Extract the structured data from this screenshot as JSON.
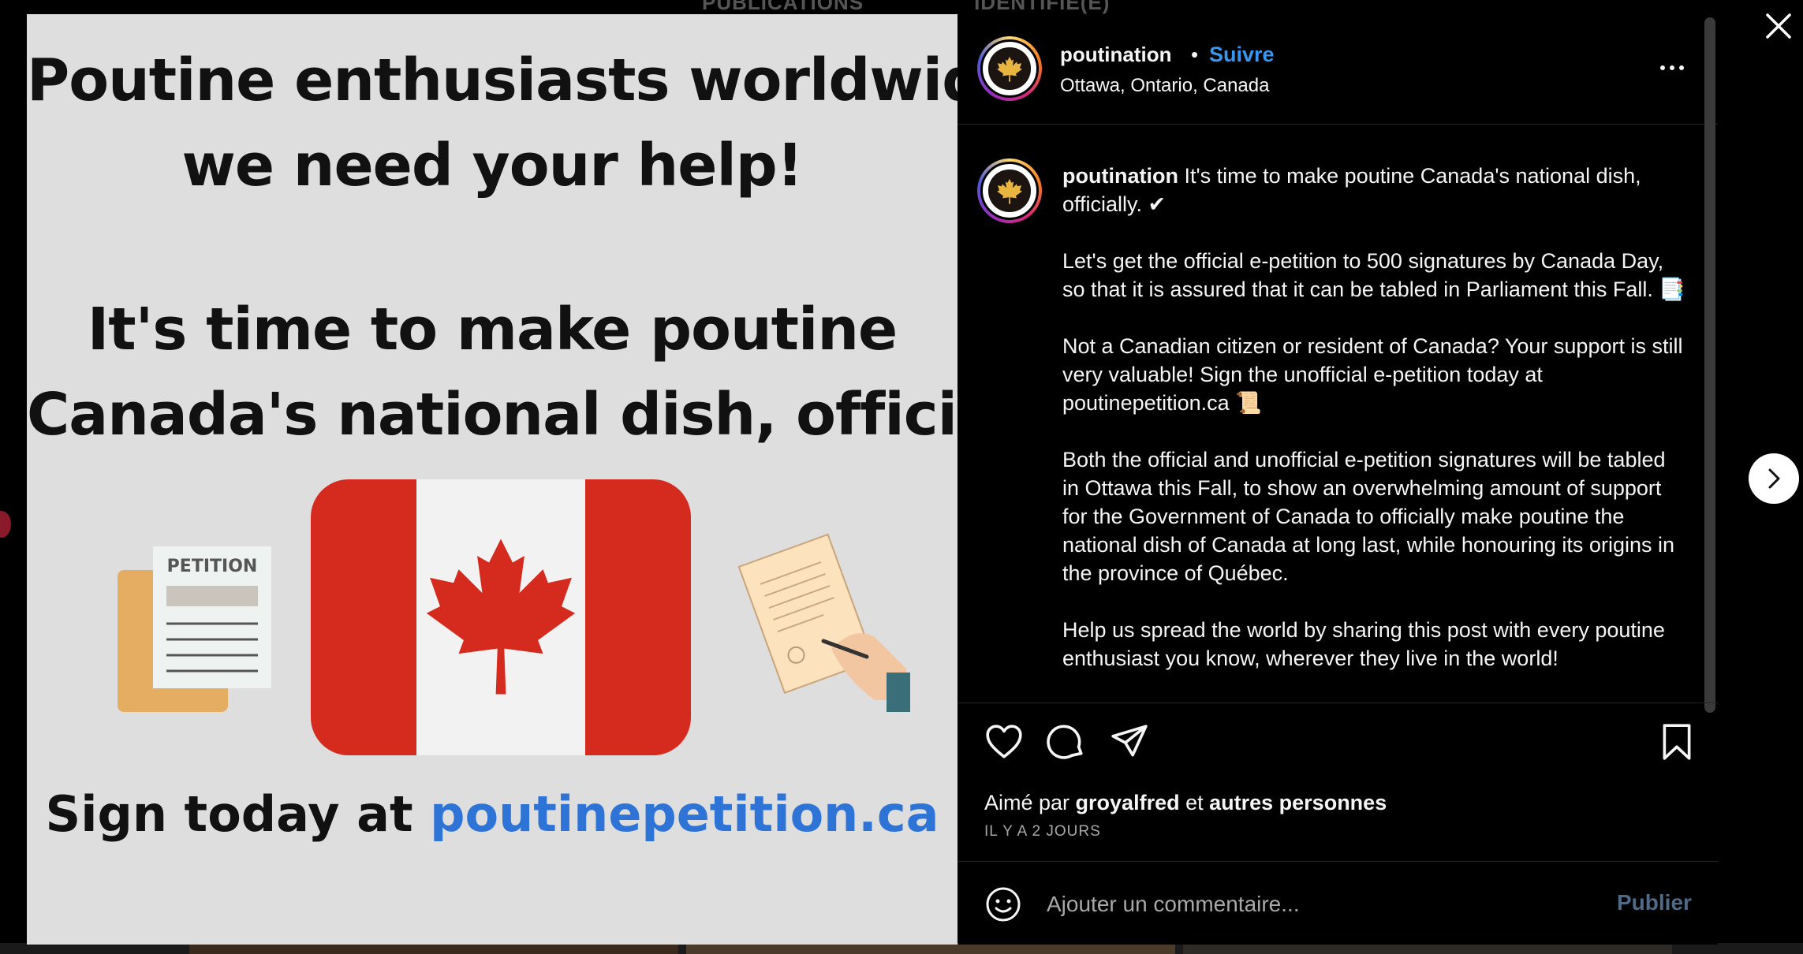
{
  "background": {
    "tabs": [
      "PUBLICATIONS",
      "IDENTIFIÉ(E)"
    ]
  },
  "image": {
    "heading_lines": [
      "Poutine enthusiasts worldwide,",
      "we need your help!"
    ],
    "subheading_lines": [
      "It's time to make poutine",
      "Canada's national dish, officially."
    ],
    "petition_label": "PETITION",
    "cta_prefix": "Sign today at ",
    "cta_url": "poutinepetition.ca",
    "colors": {
      "background": "#dedede",
      "flag_red": "#d52b1e",
      "url_blue": "#2e73d6"
    }
  },
  "header": {
    "username": "poutination",
    "separator": "•",
    "follow_label": "Suivre",
    "location": "Ottawa, Ontario, Canada",
    "more_icon": "more-horizontal-icon"
  },
  "caption": {
    "username": "poutination",
    "first_line": " It's time to make poutine Canada's national dish, officially. ✔",
    "paragraphs": [
      "Let's get the official e-petition to 500 signatures by Canada Day, so that it is assured that it can be tabled in Parliament this Fall. 📑",
      "Not a Canadian citizen or resident of Canada? Your support is still very valuable! Sign the unofficial e-petition today at poutinepetition.ca 📜",
      "Both the official and unofficial e-petition signatures will be tabled in Ottawa this Fall, to show an overwhelming amount of support for the Government of Canada to officially make poutine the national dish of Canada at long last, while honouring its origins in the province of Québec.",
      "Help us spread the world by sharing this post with every poutine enthusiast you know, wherever they live in the world!"
    ]
  },
  "engagement": {
    "liked_prefix": "Aimé par ",
    "liked_user": "groyalfred",
    "liked_and": " et ",
    "liked_others": "autres personnes",
    "timestamp": "IL Y A 2 JOURS"
  },
  "comment": {
    "placeholder": "Ajouter un commentaire...",
    "publish_label": "Publier"
  },
  "colors": {
    "accent": "#3897f0",
    "panel": "#000000",
    "text": "#f5f5f5",
    "muted": "#a8a8a8"
  }
}
